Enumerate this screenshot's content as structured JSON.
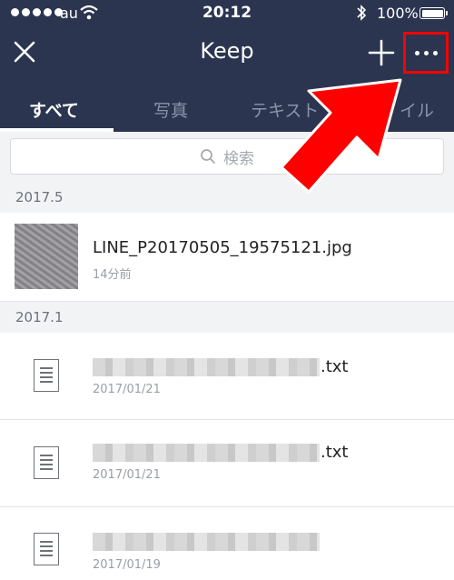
{
  "status_bar": {
    "carrier": "au",
    "time": "20:12",
    "battery": "100%"
  },
  "nav": {
    "title": "Keep",
    "close_icon": "close-icon",
    "add_icon": "plus-icon",
    "more_icon": "more-dots-icon"
  },
  "tabs": [
    {
      "label": "すべて",
      "active": true
    },
    {
      "label": "写真",
      "active": false
    },
    {
      "label": "テキスト",
      "active": false
    },
    {
      "label": "イル",
      "active": false
    }
  ],
  "search": {
    "placeholder": "検索",
    "icon": "search-icon"
  },
  "sections": [
    {
      "label": "2017.5",
      "items": [
        {
          "name": "LINE_P20170505_19575121.jpg",
          "meta": "14分前",
          "icon": "photo-thumbnail"
        }
      ]
    },
    {
      "label": "2017.1",
      "items": [
        {
          "name": ".txt",
          "meta": "2017/01/21",
          "icon": "text-file-icon"
        },
        {
          "name": ".txt",
          "meta": "2017/01/21",
          "icon": "text-file-icon"
        },
        {
          "name": "",
          "meta": "2017/01/19",
          "icon": "text-file-icon"
        }
      ]
    }
  ],
  "colors": {
    "header": "#2b3550",
    "annotation": "#ff0000",
    "section_background": "#f2f3f5"
  }
}
